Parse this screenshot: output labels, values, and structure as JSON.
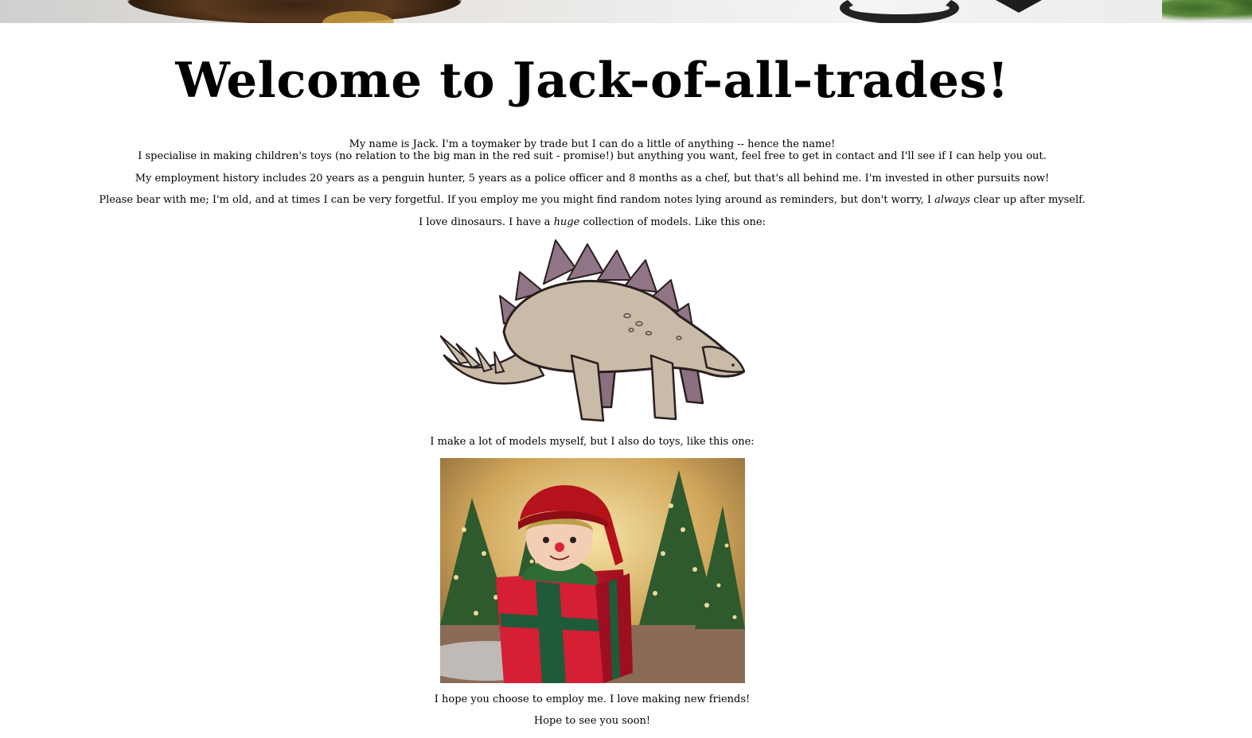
{
  "banner": {
    "description_icon": "header-banner-photo"
  },
  "heading": "Welcome to Jack-of-all-trades!",
  "intro": {
    "line1": "My name is Jack. I'm a toymaker by trade but I can do a little of anything -- hence the name!",
    "line2": "I specialise in making children's toys (no relation to the big man in the red suit - promise!) but anything you want, feel free to get in contact and I'll see if I can help you out."
  },
  "employment": "My employment history includes 20 years as a penguin hunter, 5 years as a police officer and 8 months as a chef, but that's all behind me. I'm invested in other pursuits now!",
  "bear_with_me": {
    "before": "Please bear with me; I'm old, and at times I can be very forgetful. If you employ me you might find random notes lying around as reminders, but don't worry, I ",
    "emphasis": "always",
    "after": " clear up after myself."
  },
  "dinosaurs": {
    "before": "I love dinosaurs. I have a ",
    "emphasis": "huge",
    "after": " collection of models. Like this one:"
  },
  "toys_intro": "I make a lot of models myself, but I also do toys, like this one:",
  "hope_employ": "I hope you choose to employ me. I love making new friends!",
  "farewell": "Hope to see you soon!",
  "images": {
    "dino_icon": "stegosaurus-illustration",
    "elf_icon": "elf-toy-in-gift-box-photo"
  },
  "colors": {
    "dino_body": "#c9bba8",
    "dino_plates": "#8f7585",
    "gift_red": "#c8102e",
    "ribbon_green": "#1f5a3a",
    "hat_red": "#b5121b"
  }
}
